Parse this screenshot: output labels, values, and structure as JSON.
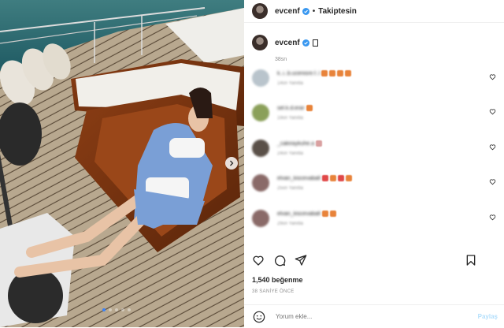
{
  "post": {
    "username": "evcenf",
    "separator": "•",
    "follow_label": "Takiptesin",
    "caption_time": "38sn",
    "likes": "1,540 beğenme",
    "time_ago": "38 SANİYE ÖNCE"
  },
  "comments": [
    {
      "user": "k..i..b.ucenisre.f..l",
      "meta": "14sn  Yanıtla",
      "avatar_color": "#b9c4cc",
      "emoji_colors": [
        "#e8833a",
        "#e8833a",
        "#e8833a",
        "#e8833a"
      ]
    },
    {
      "user": "sel.k.d.erar",
      "meta": "19sn  Yanıtla",
      "avatar_color": "#8ba05a",
      "emoji_colors": [
        "#e8833a"
      ]
    },
    {
      "user": "_cakiraykuhe.a",
      "meta": "24sn  Yanıtla",
      "avatar_color": "#5a5048",
      "emoji_colors": [
        "#d9a0a0"
      ]
    },
    {
      "user": "elvan_kiscevaball",
      "meta": "25sn  Yanıtla",
      "avatar_color": "#8a6a68",
      "emoji_colors": [
        "#e04848",
        "#e8833a",
        "#e04848",
        "#e8833a"
      ]
    },
    {
      "user": "elvan_kiscevaball",
      "meta": "29sn  Yanıtla",
      "avatar_color": "#8a6a68",
      "emoji_colors": [
        "#e8833a",
        "#e8833a"
      ]
    }
  ],
  "comment_input": {
    "placeholder": "Yorum ekle...",
    "post_label": "Paylaş"
  },
  "colors": {
    "verified_blue": "#3897f0",
    "post_disabled": "#b2dffc",
    "muted": "#8e8e8e"
  },
  "icons": [
    "verified-icon",
    "heart-icon",
    "comment-icon",
    "share-icon",
    "save-icon",
    "smile-icon",
    "chevron-right-icon"
  ]
}
